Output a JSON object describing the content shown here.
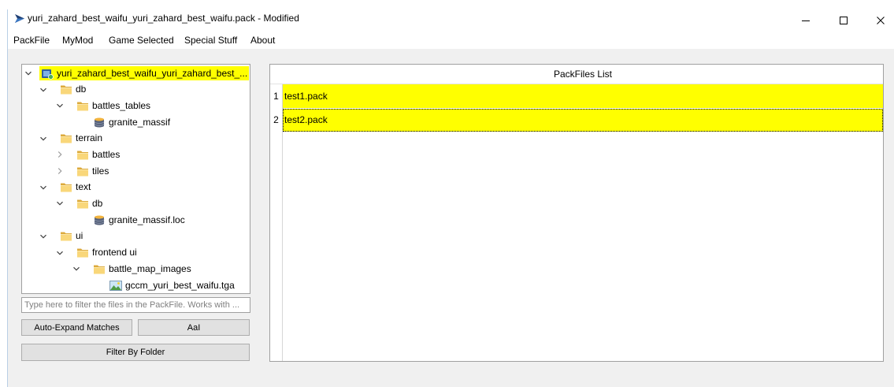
{
  "window": {
    "title": "yuri_zahard_best_waifu_yuri_zahard_best_waifu.pack - Modified",
    "app_icon": "rpfm-app-icon",
    "controls": [
      "minimize-icon",
      "maximize-icon",
      "close-icon"
    ]
  },
  "menu": {
    "items": [
      "PackFile",
      "MyMod",
      "Game Selected",
      "Special Stuff",
      "About"
    ]
  },
  "tree": {
    "items": [
      {
        "label": "yuri_zahard_best_waifu_yuri_zahard_best_...",
        "level": 0,
        "icon": "packfile-icon",
        "expanded": true,
        "highlighted": true
      },
      {
        "label": "db",
        "level": 1,
        "icon": "folder-icon",
        "expanded": true
      },
      {
        "label": "battles_tables",
        "level": 2,
        "icon": "folder-icon",
        "expanded": true
      },
      {
        "label": "granite_massif",
        "level": 3,
        "icon": "database-icon"
      },
      {
        "label": "terrain",
        "level": 1,
        "icon": "folder-icon",
        "expanded": true
      },
      {
        "label": "battles",
        "level": 2,
        "icon": "folder-icon",
        "expanded": false
      },
      {
        "label": "tiles",
        "level": 2,
        "icon": "folder-icon",
        "expanded": false
      },
      {
        "label": "text",
        "level": 1,
        "icon": "folder-icon",
        "expanded": true
      },
      {
        "label": "db",
        "level": 2,
        "icon": "folder-icon",
        "expanded": true
      },
      {
        "label": "granite_massif.loc",
        "level": 3,
        "icon": "database-icon"
      },
      {
        "label": "ui",
        "level": 1,
        "icon": "folder-icon",
        "expanded": true
      },
      {
        "label": "frontend ui",
        "level": 2,
        "icon": "folder-icon",
        "expanded": true
      },
      {
        "label": "battle_map_images",
        "level": 3,
        "icon": "folder-icon",
        "expanded": true
      },
      {
        "label": "gccm_yuri_best_waifu.tga",
        "level": 4,
        "icon": "image-icon"
      }
    ]
  },
  "filter": {
    "placeholder": "Type here to filter the files in the PackFile. Works with ...",
    "value": "",
    "auto_expand_label": "Auto-Expand Matches",
    "case_sensitive_label": "AaI",
    "filter_by_folder_label": "Filter By Folder"
  },
  "packfiles_list": {
    "header": "PackFiles List",
    "rows": [
      {
        "number": "1",
        "name": "test1.pack",
        "highlighted": true
      },
      {
        "number": "2",
        "name": "test2.pack",
        "highlighted": true,
        "focused": true
      }
    ]
  },
  "colors": {
    "match_highlight": "#ffff00",
    "panel_background": "#f0f0f0",
    "content_background": "#ffffff"
  }
}
